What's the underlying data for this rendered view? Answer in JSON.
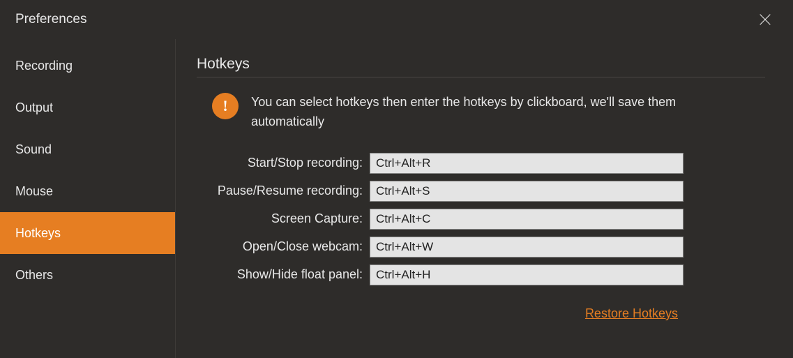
{
  "header": {
    "title": "Preferences"
  },
  "sidebar": {
    "items": [
      {
        "label": "Recording",
        "active": false
      },
      {
        "label": "Output",
        "active": false
      },
      {
        "label": "Sound",
        "active": false
      },
      {
        "label": "Mouse",
        "active": false
      },
      {
        "label": "Hotkeys",
        "active": true
      },
      {
        "label": "Others",
        "active": false
      }
    ]
  },
  "main": {
    "section_title": "Hotkeys",
    "info_text": "You can select hotkeys then enter the hotkeys by clickboard, we'll save them automatically",
    "info_glyph": "!",
    "rows": [
      {
        "label": "Start/Stop recording:",
        "value": "Ctrl+Alt+R"
      },
      {
        "label": "Pause/Resume recording:",
        "value": "Ctrl+Alt+S"
      },
      {
        "label": "Screen Capture:",
        "value": "Ctrl+Alt+C"
      },
      {
        "label": "Open/Close webcam:",
        "value": "Ctrl+Alt+W"
      },
      {
        "label": "Show/Hide float panel:",
        "value": "Ctrl+Alt+H"
      }
    ],
    "restore_label": "Restore Hotkeys"
  }
}
